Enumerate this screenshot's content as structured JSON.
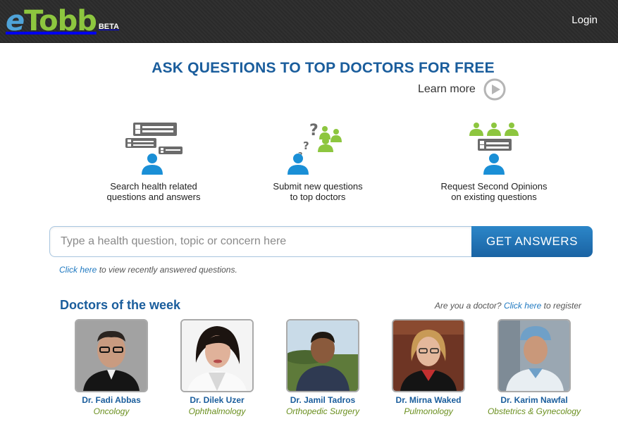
{
  "header": {
    "logo_e": "e",
    "logo_tobb": "Tobb",
    "logo_beta": "BETA",
    "login_label": "Login"
  },
  "hero": {
    "headline": "ASK QUESTIONS TO TOP DOCTORS FOR FREE",
    "learn_more": "Learn more"
  },
  "features": [
    {
      "icon": "search-qa-icon",
      "line1": "Search health related",
      "line2": "questions and answers"
    },
    {
      "icon": "ask-doctors-icon",
      "line1": "Submit new questions",
      "line2": "to top doctors"
    },
    {
      "icon": "second-opinion-icon",
      "line1": "Request Second Opinions",
      "line2": "on existing questions"
    }
  ],
  "search": {
    "placeholder": "Type a health question, topic or concern here",
    "button_label": "GET ANSWERS",
    "recent_link": "Click here",
    "recent_text": " to view recently answered questions."
  },
  "doctors_section": {
    "title": "Doctors of the week",
    "register_prefix": "Are you a doctor? ",
    "register_link": "Click here",
    "register_suffix": " to register"
  },
  "doctors": [
    {
      "name": "Dr. Fadi Abbas",
      "specialty": "Oncology"
    },
    {
      "name": "Dr. Dilek Uzer",
      "specialty": "Ophthalmology"
    },
    {
      "name": "Dr. Jamil Tadros",
      "specialty": "Orthopedic Surgery"
    },
    {
      "name": "Dr. Mirna Waked",
      "specialty": "Pulmonology"
    },
    {
      "name": "Dr. Karim Nawfal",
      "specialty": "Obstetrics & Gynecology"
    }
  ],
  "colors": {
    "brand_blue": "#1a5d9c",
    "link_blue": "#1f79c1",
    "logo_green": "#8dc63f",
    "icon_blue": "#1a8fd6",
    "icon_green": "#8dc63f",
    "icon_gray": "#6b6b6b"
  }
}
